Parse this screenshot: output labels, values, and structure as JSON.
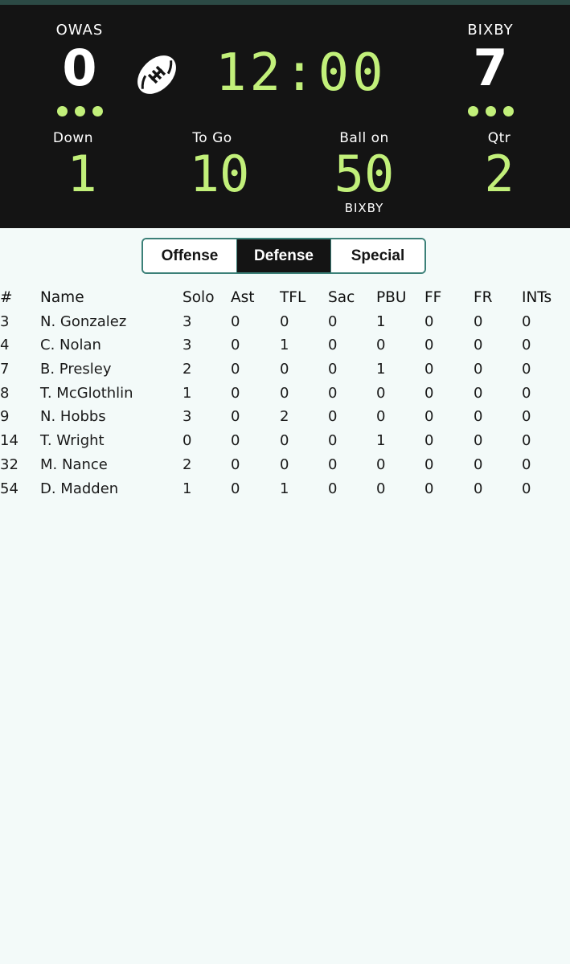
{
  "scoreboard": {
    "home": {
      "name": "OWAS",
      "score": "0",
      "timeouts": 3
    },
    "away": {
      "name": "BIXBY",
      "score": "7",
      "timeouts": 3
    },
    "possession_icon": "football-icon",
    "clock": "12:00",
    "down": {
      "label": "Down",
      "value": "1"
    },
    "to_go": {
      "label": "To Go",
      "value": "10"
    },
    "ball_on": {
      "label": "Ball on",
      "value": "50",
      "side": "BIXBY"
    },
    "quarter": {
      "label": "Qtr",
      "value": "2"
    },
    "colors": {
      "background": "#141414",
      "digits": "#c2f07a",
      "text": "#ffffff"
    }
  },
  "tabs": {
    "items": [
      "Offense",
      "Defense",
      "Special"
    ],
    "selected": "Defense"
  },
  "table": {
    "headers": [
      "#",
      "Name",
      "Solo",
      "Ast",
      "TFL",
      "Sac",
      "PBU",
      "FF",
      "FR",
      "INTs"
    ],
    "rows": [
      [
        "3",
        "N. Gonzalez",
        "3",
        "0",
        "0",
        "0",
        "1",
        "0",
        "0",
        "0"
      ],
      [
        "4",
        "C. Nolan",
        "3",
        "0",
        "1",
        "0",
        "0",
        "0",
        "0",
        "0"
      ],
      [
        "7",
        "B. Presley",
        "2",
        "0",
        "0",
        "0",
        "1",
        "0",
        "0",
        "0"
      ],
      [
        "8",
        "T. McGlothlin",
        "1",
        "0",
        "0",
        "0",
        "0",
        "0",
        "0",
        "0"
      ],
      [
        "9",
        "N. Hobbs",
        "3",
        "0",
        "2",
        "0",
        "0",
        "0",
        "0",
        "0"
      ],
      [
        "14",
        "T. Wright",
        "0",
        "0",
        "0",
        "0",
        "1",
        "0",
        "0",
        "0"
      ],
      [
        "32",
        "M. Nance",
        "2",
        "0",
        "0",
        "0",
        "0",
        "0",
        "0",
        "0"
      ],
      [
        "54",
        "D. Madden",
        "1",
        "0",
        "1",
        "0",
        "0",
        "0",
        "0",
        "0"
      ]
    ]
  },
  "theme": {
    "page_bg": "#f3faf9",
    "accent_border": "#3b8078"
  }
}
